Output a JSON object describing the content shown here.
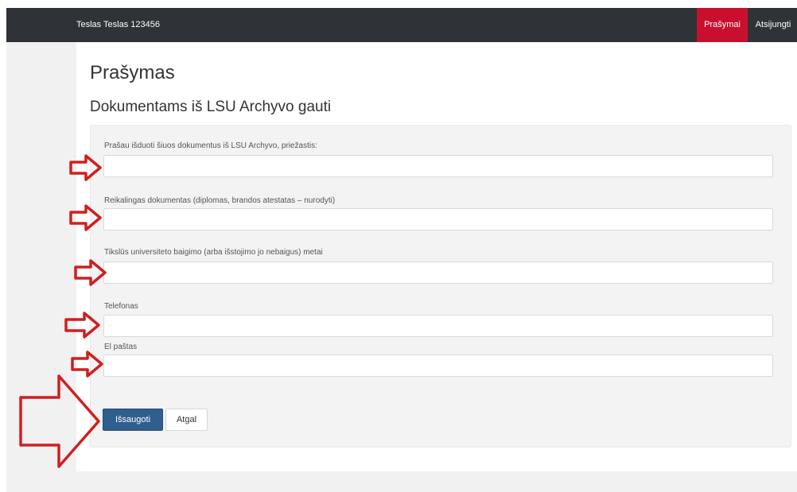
{
  "navbar": {
    "user_label": "Teslas Teslas 123456",
    "requests_link": "Prašymai",
    "logout_link": "Atsijungti"
  },
  "page": {
    "title": "Prašymas",
    "subtitle": "Dokumentams iš LSU Archyvo gauti"
  },
  "form": {
    "fields": [
      {
        "label": "Prašau išduoti šiuos dokumentus iš LSU Archyvo, priežastis:",
        "value": "",
        "placeholder": ""
      },
      {
        "label": "Reikalingas dokumentas (diplomas, brandos atestatas – nurodyti)",
        "value": "",
        "placeholder": ""
      },
      {
        "label": "Tikslūs universiteto baigimo (arba išstojimo jo nebaigus) metai",
        "value": "",
        "placeholder": ""
      },
      {
        "label": "Telefonas",
        "value": "",
        "placeholder": ""
      },
      {
        "label": "El paštas",
        "value": "",
        "placeholder": ""
      }
    ],
    "save_button": "Išsaugoti",
    "back_button": "Atgal"
  },
  "colors": {
    "navbar_bg": "#2f3236",
    "active_link_bg": "#c8102e",
    "primary_button": "#2f5f8f",
    "annotation_arrow": "#d01f1f"
  }
}
